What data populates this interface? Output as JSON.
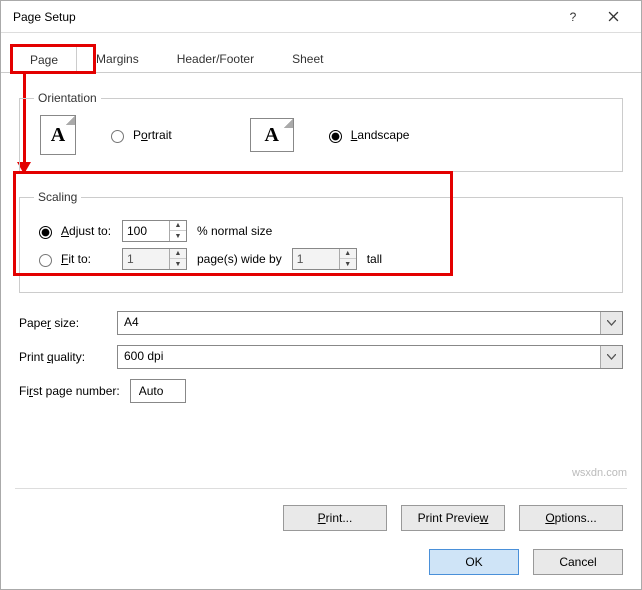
{
  "title": "Page Setup",
  "tabs": {
    "page": "Page",
    "margins": "Margins",
    "headerfooter": "Header/Footer",
    "sheet": "Sheet"
  },
  "orientation": {
    "legend": "Orientation",
    "portrait": "Portrait",
    "landscape": "Landscape",
    "selected": "landscape"
  },
  "scaling": {
    "legend": "Scaling",
    "adjust_label": "Adjust to:",
    "adjust_value": "100",
    "adjust_suffix": "% normal size",
    "fit_label": "Fit to:",
    "fit_wide": "1",
    "fit_mid": "page(s) wide by",
    "fit_tall": "1",
    "fit_suffix": "tall",
    "selected": "adjust"
  },
  "paper": {
    "label": "Paper size:",
    "value": "A4"
  },
  "quality": {
    "label": "Print quality:",
    "value": "600 dpi"
  },
  "firstpage": {
    "label": "First page number:",
    "value": "Auto"
  },
  "buttons": {
    "print": "Print...",
    "preview": "Print Preview",
    "options": "Options...",
    "ok": "OK",
    "cancel": "Cancel"
  },
  "watermark": "wsxdn.com"
}
